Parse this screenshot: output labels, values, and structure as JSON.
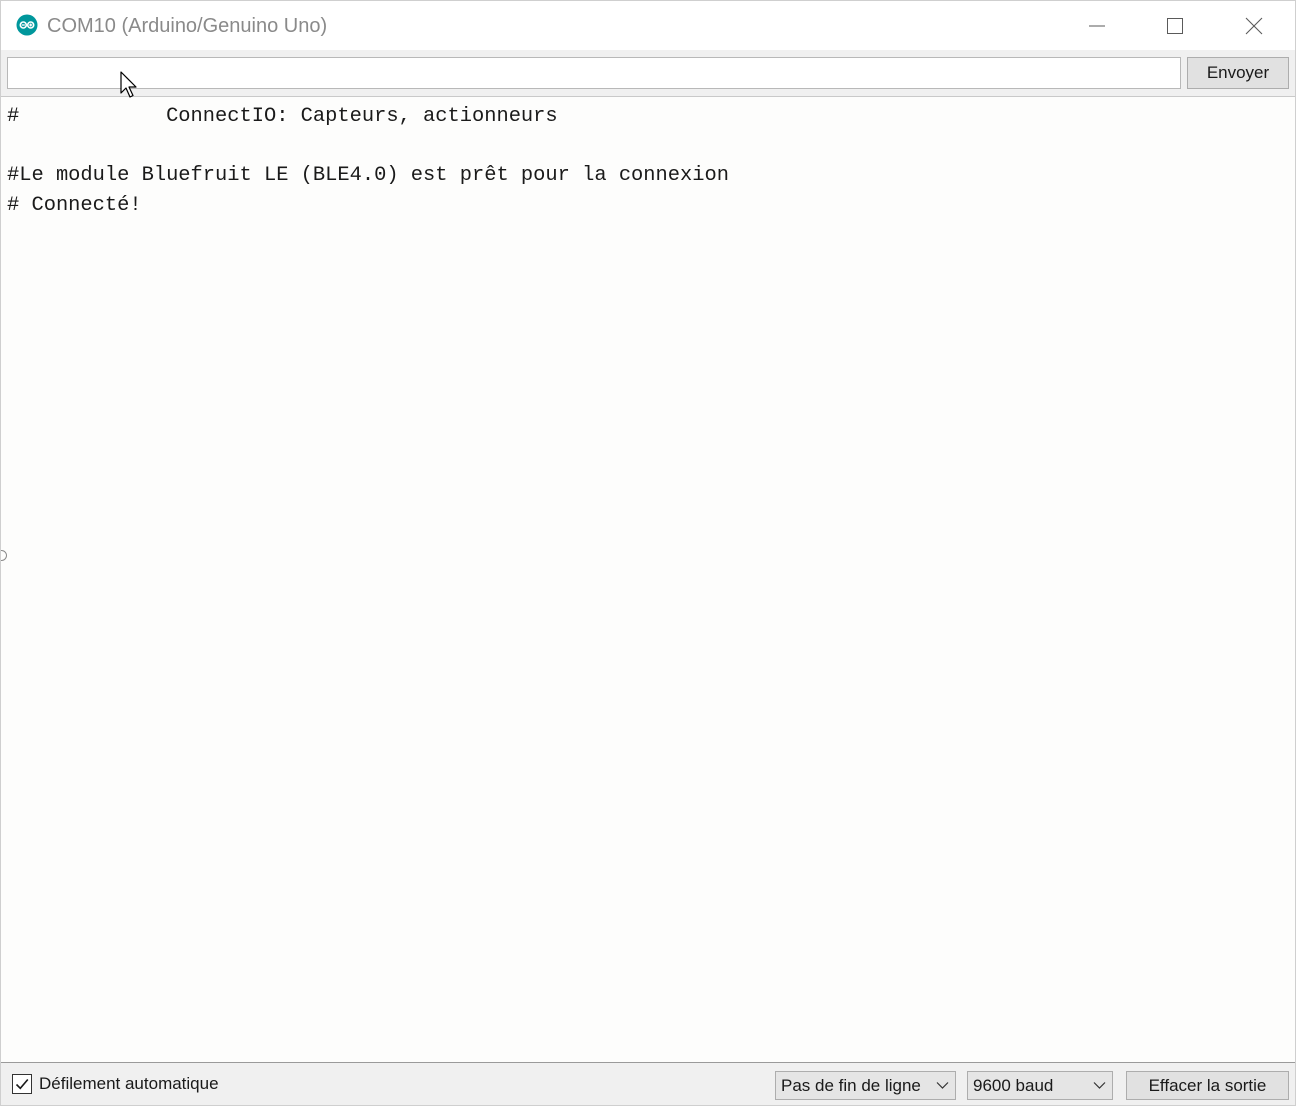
{
  "window": {
    "title": "COM10 (Arduino/Genuino Uno)",
    "app_icon": "arduino-logo-icon",
    "accent_color": "#00979c"
  },
  "window_controls": {
    "minimize_icon": "minimize-icon",
    "maximize_icon": "maximize-icon",
    "close_icon": "close-icon"
  },
  "send": {
    "input_value": "",
    "input_placeholder": "",
    "button_label": "Envoyer"
  },
  "output": {
    "lines": [
      "#            ConnectIO: Capteurs, actionneurs",
      "",
      "#Le module Bluefruit LE (BLE4.0) est prêt pour la connexion",
      "# Connecté!"
    ]
  },
  "bottom_bar": {
    "autoscroll_label": "Défilement automatique",
    "autoscroll_checked": true,
    "line_ending_selected": "Pas de fin de ligne",
    "baud_selected": "9600 baud",
    "clear_label": "Effacer la sortie"
  }
}
